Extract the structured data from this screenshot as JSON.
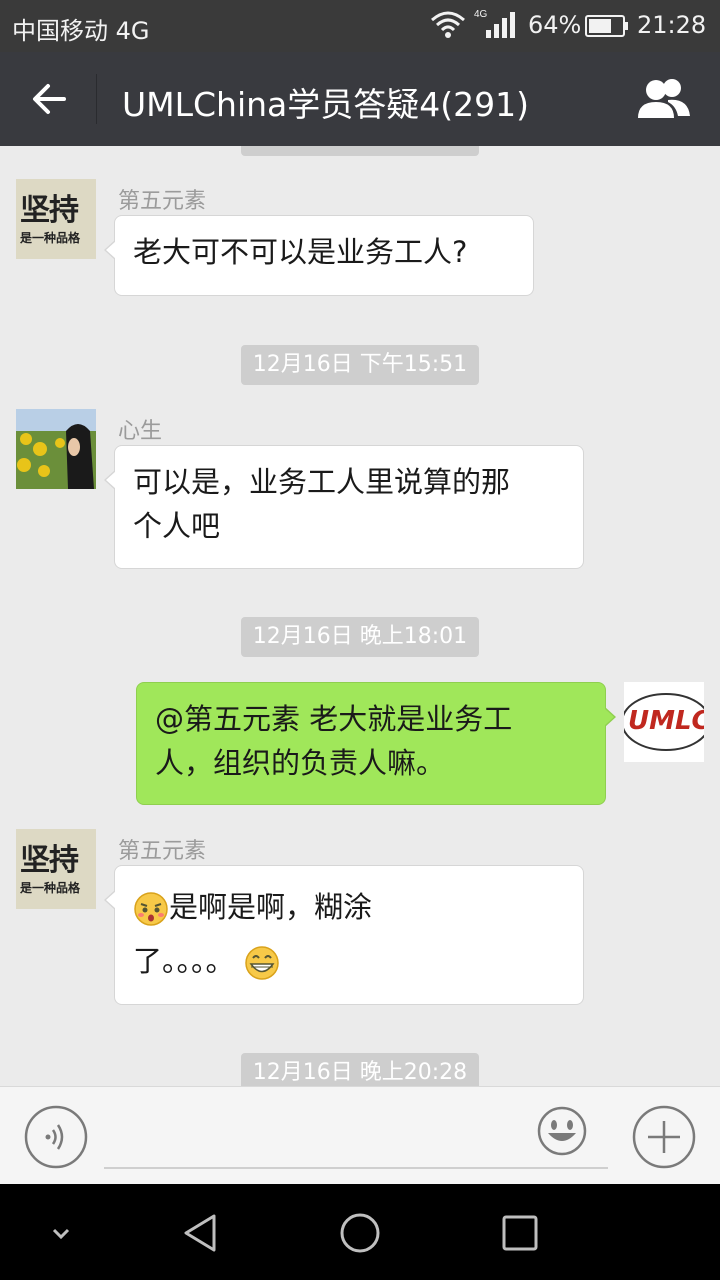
{
  "status_bar": {
    "carrier": "中国移动 4G",
    "network_badge": "4G",
    "battery": "64%",
    "time": "21:28"
  },
  "header": {
    "title": "UMLChina学员答疑4(291)",
    "back_icon": "arrow-left-icon",
    "members_icon": "group-icon"
  },
  "messages": [
    {
      "type": "time",
      "text": "12月16日 下午15:51"
    },
    {
      "type": "time",
      "text": "12月16日 晚上18:01"
    },
    {
      "type": "time",
      "text": "12月16日 晚上20:28"
    }
  ],
  "chat": {
    "m1": {
      "sender": "第五元素",
      "lines": [
        "老大可不可以是业务工人?"
      ],
      "avatar_text_big": "坚持",
      "avatar_text_small": "是一种品格"
    },
    "m2": {
      "sender": "心生",
      "lines": [
        "可以是，业务工人里说算的那",
        "个人吧"
      ]
    },
    "m3": {
      "lines": [
        "@第五元素 老大就是业务工",
        "人，组织的负责人嘛。"
      ],
      "avatar_text": "UMLC"
    },
    "m4": {
      "sender": "第五元素",
      "line1": "是啊是啊，糊涂",
      "line2": "了。。。。",
      "avatar_text_big": "坚持",
      "avatar_text_small": "是一种品格"
    }
  },
  "input_bar": {
    "placeholder": ""
  },
  "colors": {
    "header_bg": "#393a3f",
    "chat_bg": "#ebebeb",
    "self_bubble": "#a0e75a",
    "time_pill": "#cecece"
  }
}
